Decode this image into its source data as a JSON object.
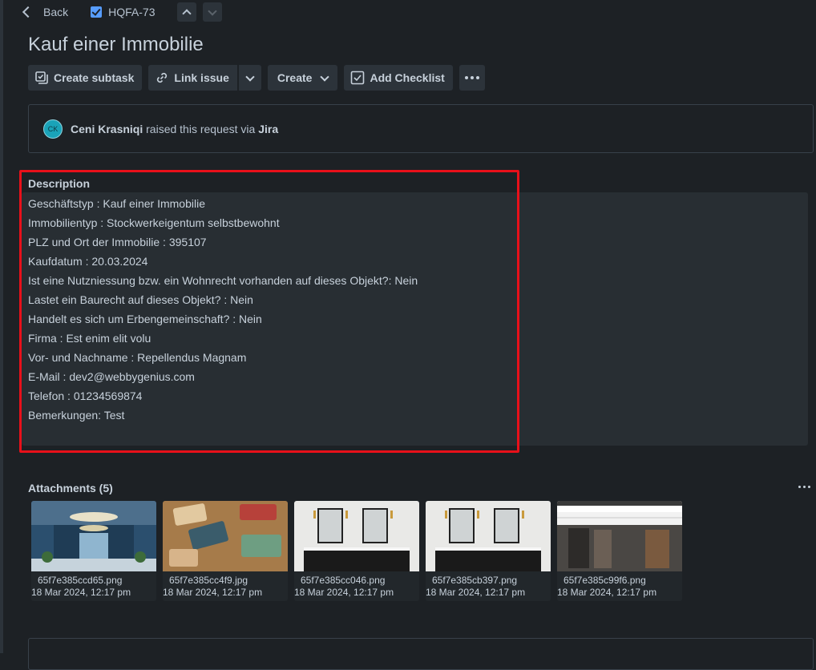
{
  "topbar": {
    "back_label": "Back",
    "issue_key": "HQFA-73"
  },
  "title": "Kauf einer Immobilie",
  "toolbar": {
    "create_subtask": "Create subtask",
    "link_issue": "Link issue",
    "create": "Create",
    "add_checklist": "Add Checklist"
  },
  "request": {
    "avatar_initials": "CK",
    "reporter": "Ceni Krasniqi",
    "text": "raised this request via",
    "channel": "Jira"
  },
  "description": {
    "label": "Description",
    "lines": [
      "Geschäftstyp : Kauf einer Immobilie",
      "Immobilientyp : Stockwerkeigentum selbstbewohnt",
      "PLZ und Ort der Immobilie : 395107",
      "Kaufdatum : 20.03.2024",
      "Ist eine Nutzniessung bzw. ein Wohnrecht vorhanden auf dieses Objekt?: Nein",
      "Lastet ein Baurecht auf dieses Objekt? : Nein",
      "Handelt es sich um Erbengemeinschaft? : Nein",
      "Firma : Est enim elit volu",
      "Vor- und Nachname : Repellendus Magnam",
      "E-Mail : dev2@webbygenius.com",
      "Telefon : 01234569874",
      "Bemerkungen: Test"
    ]
  },
  "attachments": {
    "label": "Attachments (5)",
    "items": [
      {
        "name": "65f7e385ccd65.png",
        "date": "18 Mar 2024, 12:17 pm"
      },
      {
        "name": "65f7e385cc4f9.jpg",
        "date": "18 Mar 2024, 12:17 pm"
      },
      {
        "name": "65f7e385cc046.png",
        "date": "18 Mar 2024, 12:17 pm"
      },
      {
        "name": "65f7e385cb397.png",
        "date": "18 Mar 2024, 12:17 pm"
      },
      {
        "name": "65f7e385c99f6.png",
        "date": "18 Mar 2024, 12:17 pm"
      }
    ]
  },
  "colors": {
    "accent": "#579dff",
    "highlight": "#e8101a",
    "background": "#1d2125"
  }
}
